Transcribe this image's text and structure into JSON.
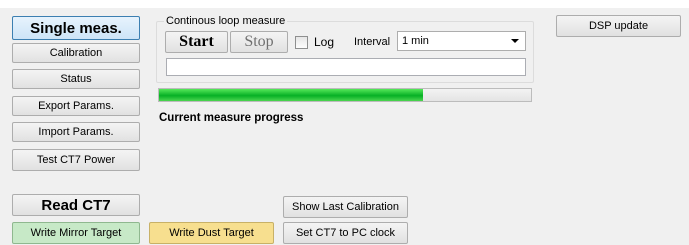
{
  "left_panel": {
    "single_meas_label": "Single meas.",
    "calibration_label": "Calibration",
    "status_label": "Status",
    "export_params_label": "Export Params.",
    "import_params_label": "Import Params.",
    "test_ct7_power_label": "Test CT7 Power",
    "read_ct7_label": "Read CT7",
    "write_mirror_target_label": "Write Mirror Target"
  },
  "loop_group": {
    "legend": "Continous loop measure",
    "start_label": "Start",
    "stop_label": "Stop",
    "log_label": "Log",
    "log_checked": false,
    "interval_label": "Interval",
    "interval_value": "1 min",
    "text_value": ""
  },
  "progress": {
    "value_percent": 71,
    "caption": "Current measure progress",
    "fill_color": "#06b025"
  },
  "buttons": {
    "dsp_update_label": "DSP update",
    "show_last_calibration_label": "Show Last Calibration",
    "write_dust_target_label": "Write Dust Target",
    "set_ct7_pc_clock_label": "Set CT7 to PC clock"
  },
  "colors": {
    "green_button": "#c7e9c7",
    "yellow_button": "#f7df8f",
    "selected_button": "#cde4f7"
  }
}
